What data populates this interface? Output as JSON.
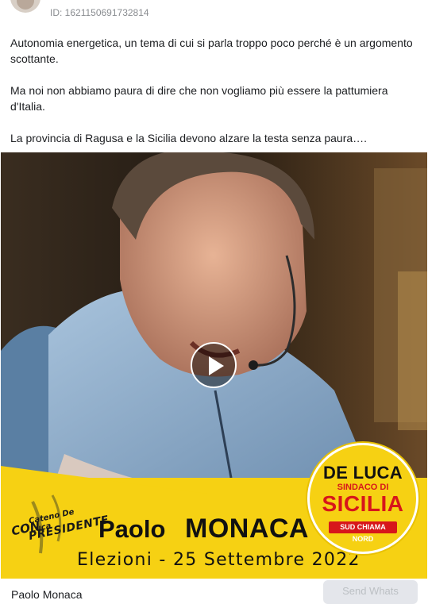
{
  "post": {
    "id_label": "ID: 1621150691732814",
    "paragraphs": [
      "Autonomia energetica, un tema di cui si parla troppo poco perché è un argomento scottante.",
      "Ma noi non abbiamo paura di dire che non vogliamo più essere la pattumiera d'Italia.",
      "La provincia di Ragusa e la Sicilia devono alzare la testa senza paura…."
    ]
  },
  "video": {
    "banner": {
      "con_word": "CON",
      "con_name": "Cateno De Luca",
      "con_role": "PRESIDENTE",
      "candidate_first": "Paolo",
      "candidate_last": "MONACA",
      "election_line": "Elezioni - 25 Settembre 2022"
    },
    "logo": {
      "line1": "DE LUCA",
      "line2": "SINDACO DI",
      "line3": "SICILIA",
      "line4": "SUD CHIAMA NORD"
    }
  },
  "footer": {
    "page_name": "Paolo Monaca",
    "send_button": "Send Whats"
  },
  "colors": {
    "banner_yellow": "#f6d113",
    "logo_red": "#d7161b",
    "meta_grey": "#8a8d91"
  }
}
